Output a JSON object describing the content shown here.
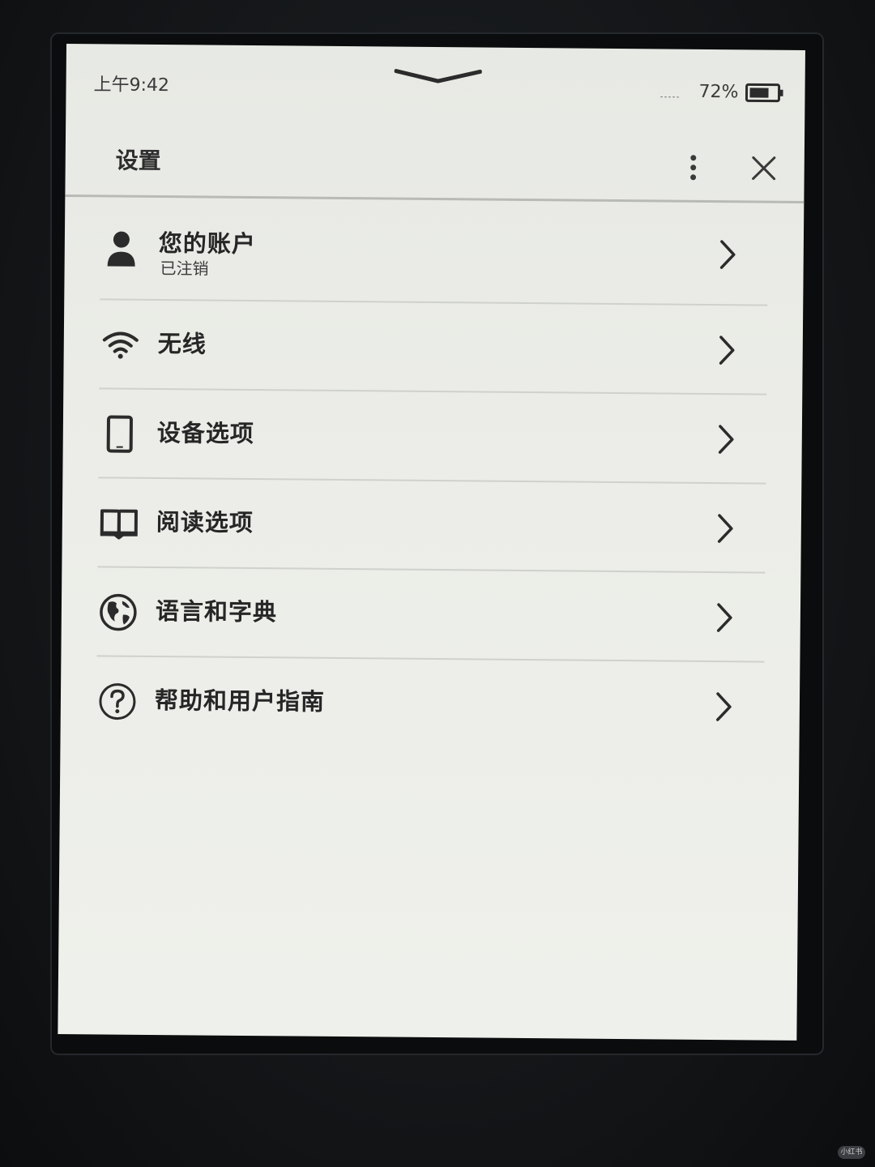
{
  "status_bar": {
    "time": "上午9:42",
    "network_indicator": "-----",
    "battery_percent": "72%",
    "battery_level": 0.72
  },
  "header": {
    "title": "设置"
  },
  "icons": {
    "more": "more-vertical-icon",
    "close": "close-icon",
    "pull_handle": "chevron-down-icon",
    "battery": "battery-icon",
    "chevron": "chevron-right-icon"
  },
  "menu": {
    "items": [
      {
        "label": "您的账户",
        "sublabel": "已注销",
        "icon": "person-icon"
      },
      {
        "label": "无线",
        "icon": "wifi-icon"
      },
      {
        "label": "设备选项",
        "icon": "device-icon"
      },
      {
        "label": "阅读选项",
        "icon": "open-book-icon"
      },
      {
        "label": "语言和字典",
        "icon": "globe-icon"
      },
      {
        "label": "帮助和用户指南",
        "icon": "help-icon"
      }
    ]
  },
  "watermark": "小红书"
}
